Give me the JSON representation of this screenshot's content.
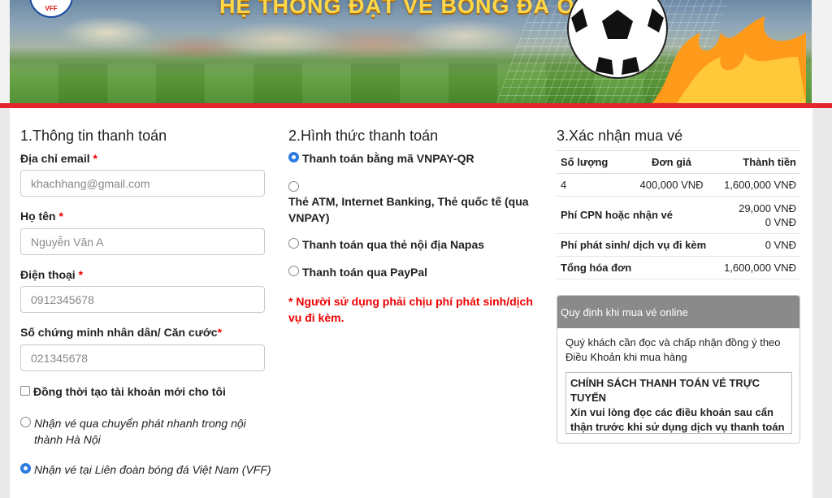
{
  "banner": {
    "title": "HỆ THỐNG ĐẶT VÉ BÓNG ĐÁ ONLINE",
    "logo_text": "VFF"
  },
  "billing": {
    "heading": "1.Thông tin thanh toán",
    "email": {
      "label": "Địa chỉ email",
      "required": "*",
      "placeholder": "khachhang@gmail.com"
    },
    "name": {
      "label": "Họ tên",
      "required": "*",
      "placeholder": "Nguyễn Văn A"
    },
    "phone": {
      "label": "Điện thoại",
      "required": "*",
      "placeholder": "0912345678"
    },
    "id_card": {
      "label": "Số chứng minh nhân dân/ Căn cước",
      "required": "*",
      "placeholder": "021345678"
    },
    "create_account": "Đồng thời tạo tài khoản mới cho tôi",
    "delivery_express": "Nhận vé qua chuyển phát nhanh trong nội thành Hà Nội",
    "delivery_vff": "Nhận vé tại Liên đoàn bóng đá Việt Nam (VFF)"
  },
  "payment": {
    "heading": "2.Hình thức thanh toán",
    "options": [
      "Thanh toán bằng mã VNPAY-QR",
      "Thẻ ATM, Internet Banking, Thẻ quốc tế (qua VNPAY)",
      "Thanh toán qua thẻ nội địa Napas",
      "Thanh toán qua PayPal"
    ],
    "selected_index": 0,
    "note": "* Người sử dụng phải chịu phí phát sinh/dịch vụ đi kèm."
  },
  "confirm": {
    "heading": "3.Xác nhận mua vé",
    "columns": [
      "Số lượng",
      "Đơn giá",
      "Thành tiền"
    ],
    "row": {
      "qty": "4",
      "unit_price": "400,000 VNĐ",
      "total": "1,600,000 VNĐ"
    },
    "shipping": {
      "label": "Phí CPN hoặc nhận vé",
      "value1": "29,000 VNĐ",
      "value2": "0 VNĐ"
    },
    "service": {
      "label": "Phí phát sinh/ dịch vụ đi kèm",
      "value": "0 VNĐ"
    },
    "grand_total": {
      "label": "Tổng hóa đơn",
      "value": "1,600,000 VNĐ"
    }
  },
  "policy": {
    "header": "Quy định khi mua vé online",
    "intro": "Quý khách cần đọc và chấp nhận đồng ý theo Điều Khoản khi mua hàng",
    "title": "CHÍNH SÁCH THANH TOÁN VÉ TRỰC TUYẾN",
    "body": "Xin vui lòng đọc các điều khoản sau cẩn thận trước khi sử dụng dịch vụ thanh toán"
  },
  "colors": {
    "accent_red": "#e4252c",
    "radio_blue": "#2d7be0",
    "policy_header": "#8a8a8a",
    "banner_title": "#ffd84a"
  }
}
